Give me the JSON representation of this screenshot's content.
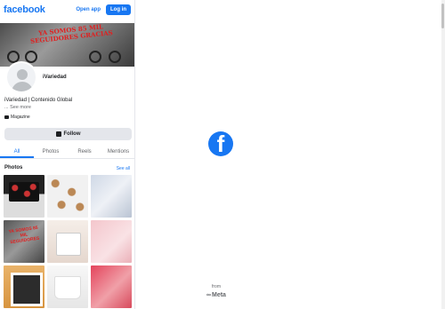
{
  "header": {
    "logo": "facebook",
    "open_app": "Open app",
    "login": "Log in"
  },
  "cover_text": "YA SOMOS 85 MIL SEGUIDORES GRACIAS",
  "page": {
    "name": "iVariedad",
    "description": "iVariedad | Contenido Global",
    "see_more": "... See more",
    "category": "Magazine",
    "follow": "Follow"
  },
  "tabs": [
    "All",
    "Photos",
    "Reels",
    "Mentions"
  ],
  "photos": {
    "title": "Photos",
    "see_all": "See all"
  },
  "grid_text": "YA SOMOS 85 MIL SEGUIDORES",
  "footer": {
    "from": "from",
    "meta": "Meta"
  },
  "colors": {
    "brand": "#1877f2",
    "accent_red": "#e02020"
  }
}
